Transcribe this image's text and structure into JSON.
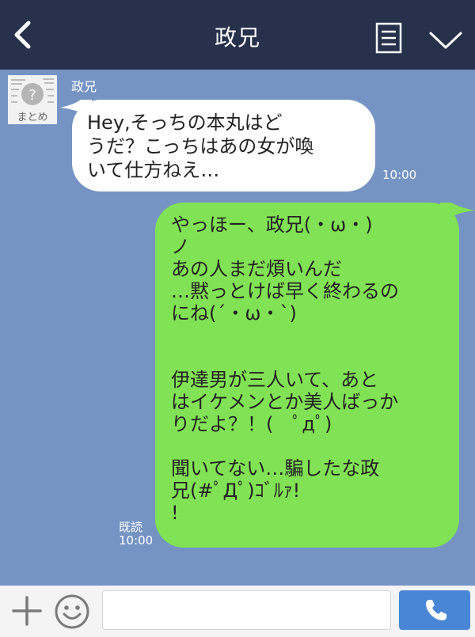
{
  "header": {
    "title": "政兄"
  },
  "incoming": {
    "sender": "政兄",
    "avatar_text": "まとめ",
    "text": "Hey,そっちの本丸はど\nうだ？こっちはあの女が喚\nいて仕方ねえ…",
    "time": "10:00"
  },
  "outgoing": {
    "text": "やっほー、政兄(・ω・)\nノ\nあの人まだ煩いんだ\n…黙っとけば早く終わるの\nにね(´・ω・`)\n\n\n伊達男が三人いて、あと\nはイケメンとか美人ばっか\nりだよ？！(　ﾟдﾟ)\n\n聞いてない…騙したな政\n兄(#ﾟДﾟ)ｺﾞﾙｧ!\n!",
    "read_label": "既読",
    "time": "10:00"
  },
  "icons": {
    "back": "chevron-left-icon",
    "note": "note-icon",
    "menu": "chevron-down-icon",
    "plus": "plus-icon",
    "sticker": "smiley-icon",
    "call": "phone-icon"
  },
  "colors": {
    "header_bg": "#27314b",
    "chat_bg": "#7594c4",
    "bubble_in": "#ffffff",
    "bubble_out": "#82e255",
    "call_button": "#4a86d6"
  }
}
